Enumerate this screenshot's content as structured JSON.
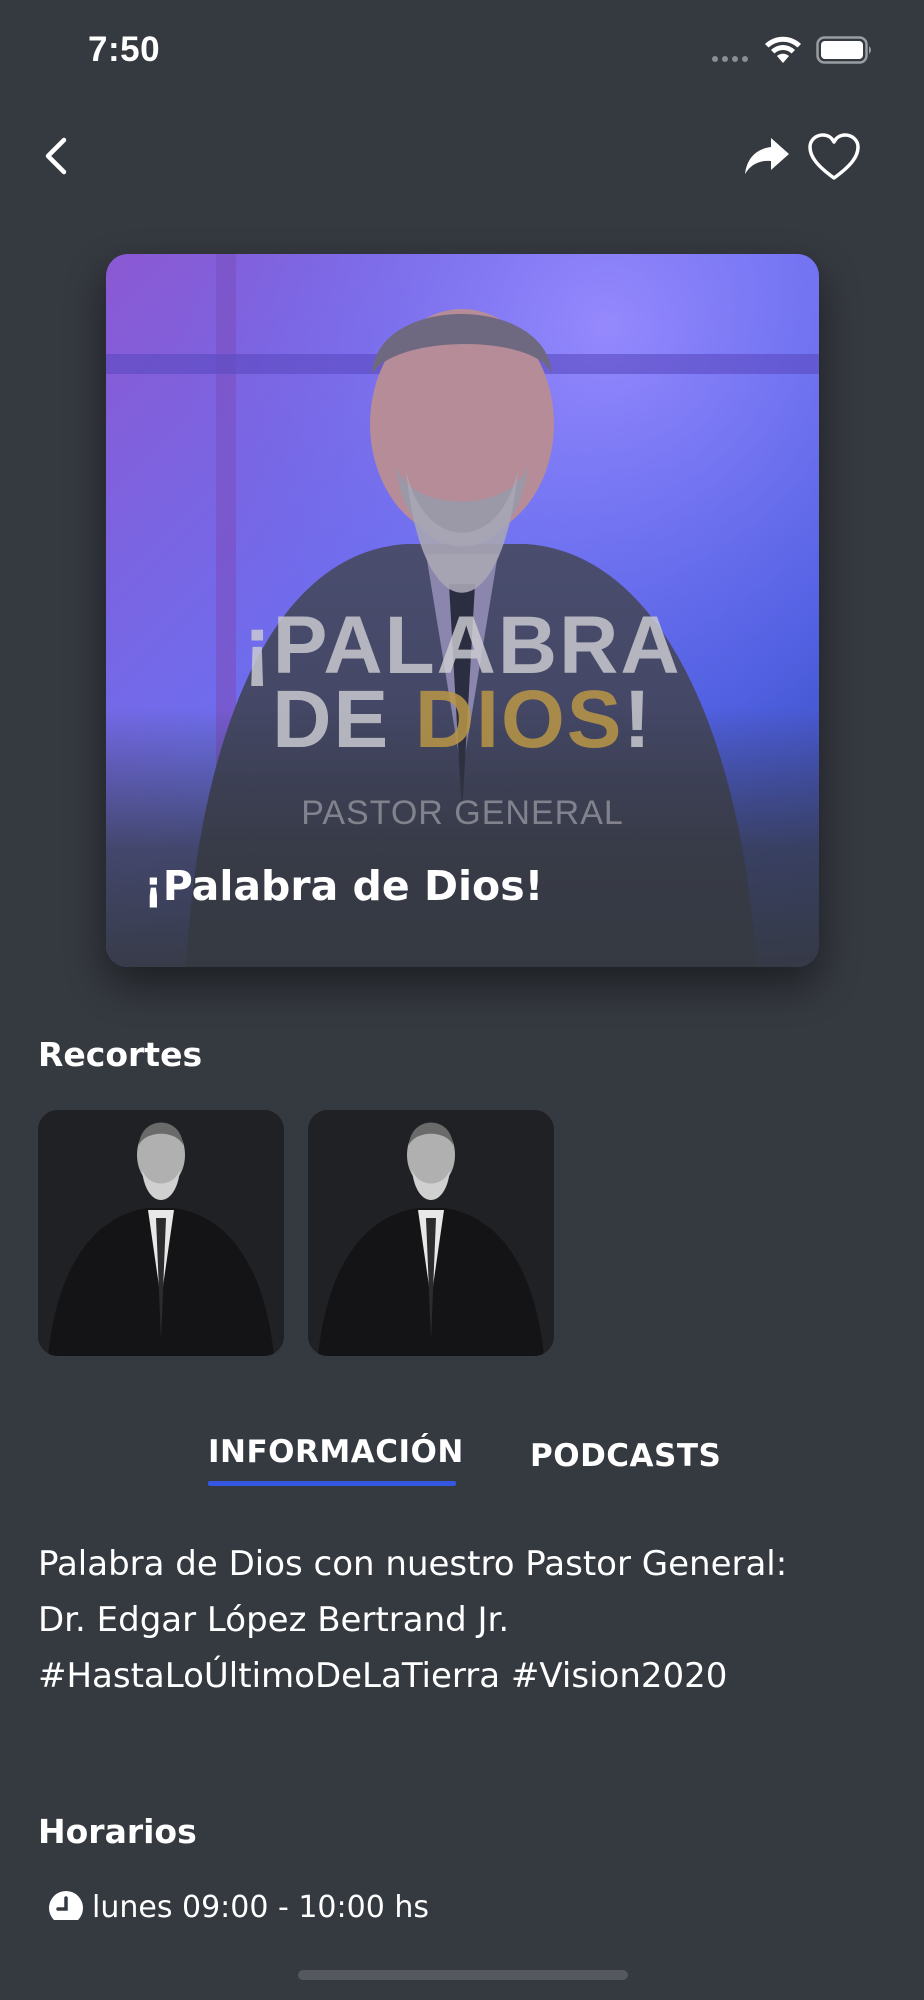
{
  "status_bar": {
    "time": "7:50"
  },
  "header": {
    "back_icon": "chevron-left-icon",
    "share_icon": "share-arrow-icon",
    "favorite_icon": "heart-outline-icon"
  },
  "hero": {
    "logo_line1": "¡PALABRA",
    "logo_line2_start": "DE ",
    "logo_line2_highlight": "DIOS",
    "logo_line2_end": "!",
    "subtitle": "PASTOR GENERAL",
    "title": "¡Palabra de Dios!"
  },
  "clips": {
    "title": "Recortes",
    "count": 2
  },
  "tabs": {
    "items": [
      {
        "label": "INFORMACIÓN",
        "active": true
      },
      {
        "label": "PODCASTS",
        "active": false
      }
    ],
    "accent": "#3556e0"
  },
  "info": {
    "line1": "Palabra de Dios con nuestro  Pastor General:",
    "line2": "Dr. Edgar López Bertrand Jr.",
    "line3": "#HastaLoÚltimoDeLaTierra #Vision2020"
  },
  "schedule": {
    "title": "Horarios",
    "items": [
      {
        "icon": "clock-icon",
        "text": "lunes 09:00 - 10:00 hs"
      }
    ]
  },
  "colors": {
    "background": "#353940",
    "text": "#ffffff"
  }
}
